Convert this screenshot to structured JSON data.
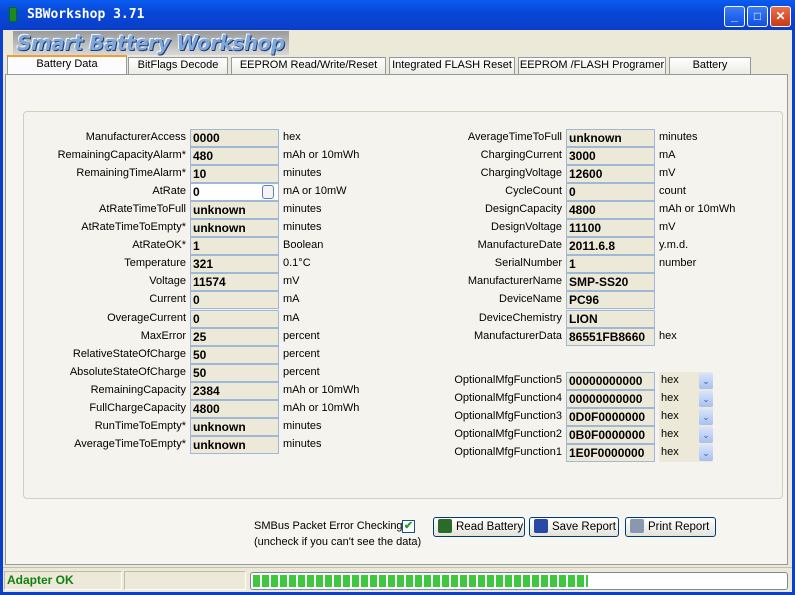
{
  "window": {
    "title": "SBWorkshop 3.71",
    "logo": "Smart Battery Workshop"
  },
  "tabs": [
    "Battery Data",
    "BitFlags Decode",
    "EEPROM Read/Write/Reset",
    "Integrated FLASH Reset",
    "EEPROM /FLASH Programer",
    "Battery Analyzer"
  ],
  "left": [
    {
      "label": "ManufacturerAccess",
      "value": "0000",
      "unit": "hex"
    },
    {
      "label": "RemainingCapacityAlarm*",
      "value": "480",
      "unit": "mAh or 10mWh"
    },
    {
      "label": "RemainingTimeAlarm*",
      "value": "10",
      "unit": "minutes"
    },
    {
      "label": "AtRate",
      "value": "0",
      "unit": "mA or 10mW"
    },
    {
      "label": "AtRateTimeToFull",
      "value": "unknown",
      "unit": "minutes"
    },
    {
      "label": "AtRateTimeToEmpty*",
      "value": "unknown",
      "unit": "minutes"
    },
    {
      "label": "AtRateOK*",
      "value": "1",
      "unit": "Boolean"
    },
    {
      "label": "Temperature",
      "value": "321",
      "unit": "0.1°C"
    },
    {
      "label": "Voltage",
      "value": "11574",
      "unit": "mV"
    },
    {
      "label": "Current",
      "value": "0",
      "unit": "mA"
    },
    {
      "label": "OverageCurrent",
      "value": "0",
      "unit": "mA"
    },
    {
      "label": "MaxError",
      "value": "25",
      "unit": "percent"
    },
    {
      "label": "RelativeStateOfCharge",
      "value": "50",
      "unit": "percent"
    },
    {
      "label": "AbsoluteStateOfCharge",
      "value": "50",
      "unit": "percent"
    },
    {
      "label": "RemainingCapacity",
      "value": "2384",
      "unit": "mAh or 10mWh"
    },
    {
      "label": "FullChargeCapacity",
      "value": "4800",
      "unit": "mAh or 10mWh"
    },
    {
      "label": "RunTimeToEmpty*",
      "value": "unknown",
      "unit": "minutes"
    },
    {
      "label": "AverageTimeToEmpty*",
      "value": "unknown",
      "unit": "minutes"
    }
  ],
  "right": [
    {
      "label": "AverageTimeToFull",
      "value": "unknown",
      "unit": "minutes"
    },
    {
      "label": "ChargingCurrent",
      "value": "3000",
      "unit": "mA"
    },
    {
      "label": "ChargingVoltage",
      "value": "12600",
      "unit": "mV"
    },
    {
      "label": "CycleCount",
      "value": "0",
      "unit": "count"
    },
    {
      "label": "DesignCapacity",
      "value": "4800",
      "unit": "mAh or 10mWh"
    },
    {
      "label": "DesignVoltage",
      "value": "11100",
      "unit": "mV"
    },
    {
      "label": "ManufactureDate",
      "value": "2011.6.8",
      "unit": "y.m.d."
    },
    {
      "label": "SerialNumber",
      "value": "1",
      "unit": "number"
    },
    {
      "label": "ManufacturerName",
      "value": "SMP-SS20",
      "unit": ""
    },
    {
      "label": "DeviceName",
      "value": "PC96",
      "unit": ""
    },
    {
      "label": "DeviceChemistry",
      "value": "LION",
      "unit": ""
    },
    {
      "label": "ManufacturerData",
      "value": "86551FB8660",
      "unit": "hex"
    }
  ],
  "optional": [
    {
      "label": "OptionalMfgFunction5",
      "value": "00000000000",
      "unit": "hex"
    },
    {
      "label": "OptionalMfgFunction4",
      "value": "00000000000",
      "unit": "hex"
    },
    {
      "label": "OptionalMfgFunction3",
      "value": "0D0F0000000",
      "unit": "hex"
    },
    {
      "label": "OptionalMfgFunction2",
      "value": "0B0F0000000",
      "unit": "hex"
    },
    {
      "label": "OptionalMfgFunction1",
      "value": "1E0F0000000",
      "unit": "hex"
    }
  ],
  "pec": {
    "label": "SMBus Packet Error Checking",
    "hint": "(uncheck if you can't see the data)",
    "checked": true
  },
  "buttons": {
    "read": "Read Battery",
    "save": "Save Report",
    "print": "Print Report"
  },
  "status": {
    "text": "Adapter OK",
    "progress_percent": 63
  }
}
